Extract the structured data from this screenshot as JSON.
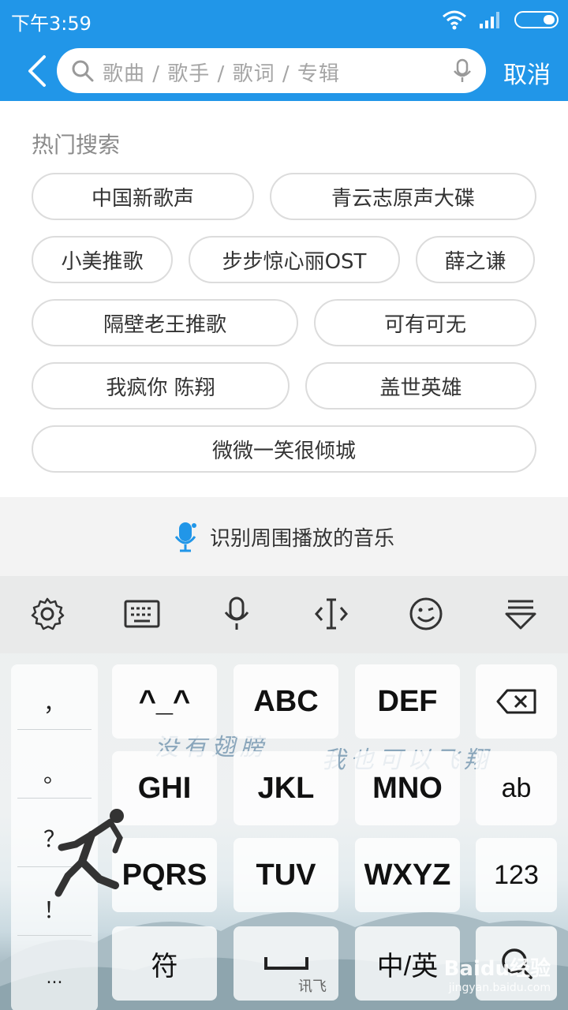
{
  "status_bar": {
    "time": "下午3:59"
  },
  "header": {
    "search_placeholder": "歌曲 / 歌手 / 歌词 / 专辑",
    "cancel_label": "取消"
  },
  "hot_search": {
    "title": "热门搜索",
    "tags": [
      "中国新歌声",
      "青云志原声大碟",
      "小美推歌",
      "步步惊心丽OST",
      "薛之谦",
      "隔壁老王推歌",
      "可有可无",
      "我疯你 陈翔",
      "盖世英雄",
      "微微一笑很倾城"
    ]
  },
  "recognize": {
    "label": "识别周围播放的音乐"
  },
  "keyboard": {
    "toolbar_icons": [
      "settings-icon",
      "keyboard-icon",
      "microphone-icon",
      "cursor-icon",
      "emoji-icon",
      "collapse-keyboard-icon"
    ],
    "symbols": [
      "，",
      "。",
      "？",
      "！",
      "..."
    ],
    "keys": {
      "k1": "^_^",
      "k2": "ABC",
      "k3": "DEF",
      "k4": "GHI",
      "k5": "JKL",
      "k6": "MNO",
      "k7": "PQRS",
      "k8": "TUV",
      "k9": "WXYZ",
      "ab": "ab",
      "num": "123",
      "fu": "符",
      "zh": "中/英"
    },
    "space_brand": "讯飞",
    "decoration_text_left": "没有翅膀",
    "decoration_text_right": "我也可以飞翔"
  },
  "watermark": {
    "main": "Baidu经验",
    "sub": "jingyan.baidu.com"
  },
  "colors": {
    "accent": "#2196e8",
    "tag_border": "#dcdcdc"
  }
}
